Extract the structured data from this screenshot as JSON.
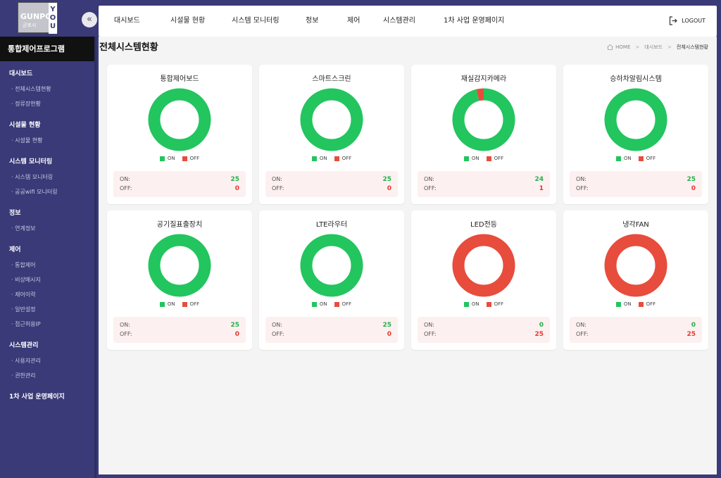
{
  "logo": {
    "text": "GUNPO",
    "sub": "군포시",
    "you": "YOU"
  },
  "sidebar": {
    "title": "통합제어프로그램",
    "groups": [
      {
        "label": "대시보드",
        "items": [
          "전체시스템현황",
          "정류장현황"
        ]
      },
      {
        "label": "시설물 현황",
        "items": [
          "시설물 현황"
        ]
      },
      {
        "label": "시스템 모니터링",
        "items": [
          "시스템 모니터링",
          "공공wifi 모니터링"
        ]
      },
      {
        "label": "정보",
        "items": [
          "연계정보"
        ]
      },
      {
        "label": "제어",
        "items": [
          "통합제어",
          "비상메시지",
          "제어이력",
          "일반설정",
          "접근허용IP"
        ]
      },
      {
        "label": "시스템관리",
        "items": [
          "사용자관리",
          "권한관리"
        ]
      },
      {
        "label": "1차 사업 운영페이지",
        "items": []
      }
    ]
  },
  "topmenu": [
    "대시보드",
    "시설물 현황",
    "시스템 모니터링",
    "정보",
    "제어",
    "시스템관리",
    "1차 사업 운영페이지"
  ],
  "logout_label": "LOGOUT",
  "page": {
    "title": "전체시스템현황",
    "breadcrumb": [
      "HOME",
      "대시보드",
      "전체시스템현황"
    ]
  },
  "labels": {
    "on": "ON",
    "off": "OFF",
    "on_row": "ON:",
    "off_row": "OFF:"
  },
  "colors": {
    "on": "#22c55e",
    "off": "#e74c3c"
  },
  "cards": [
    {
      "title": "통합제어보드",
      "on": 25,
      "off": 0
    },
    {
      "title": "스마트스크린",
      "on": 25,
      "off": 0
    },
    {
      "title": "재실감지카메라",
      "on": 24,
      "off": 1
    },
    {
      "title": "승하차알림시스템",
      "on": 25,
      "off": 0
    },
    {
      "title": "공기질표출장치",
      "on": 25,
      "off": 0
    },
    {
      "title": "LTE라우터",
      "on": 25,
      "off": 0
    },
    {
      "title": "LED전등",
      "on": 0,
      "off": 25
    },
    {
      "title": "냉각FAN",
      "on": 0,
      "off": 25
    }
  ]
}
